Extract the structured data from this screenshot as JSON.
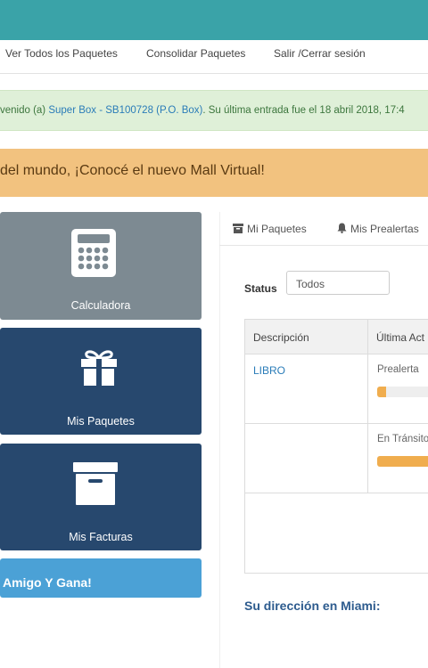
{
  "nav": {
    "items": [
      "Ver Todos los Paquetes",
      "Consolidar Paquetes",
      "Salir /Cerrar sesión"
    ]
  },
  "welcome": {
    "prefix": "venido (a) ",
    "account_link": "Super Box - SB100728 (P.O. Box)",
    "suffix": ". Su última entrada fue el 18 abril 2018, 17:4"
  },
  "promo": {
    "text": "del mundo, ¡Conocé el nuevo Mall Virtual!"
  },
  "tiles": {
    "calculator": "Calculadora",
    "packages": "Mis Paquetes",
    "invoices": "Mis Facturas",
    "referral": "Amigo Y Gana!"
  },
  "tabs": {
    "packages": "Mi Paquetes",
    "prealerts": "Mis Prealertas"
  },
  "filter": {
    "label": "Status",
    "value": "Todos"
  },
  "table": {
    "headers": [
      "Descripción",
      "Última Act"
    ],
    "rows": [
      {
        "description": "LIBRO",
        "status": "Prealerta",
        "progress": 0.12
      },
      {
        "description": "",
        "status": "En Tránsito",
        "progress": 0.8
      }
    ]
  },
  "address_heading": "Su dirección en Miami:",
  "colors": {
    "topbar": "#3aa3a8",
    "accent_blue": "#27486e",
    "progress": "#f0ad4e"
  }
}
